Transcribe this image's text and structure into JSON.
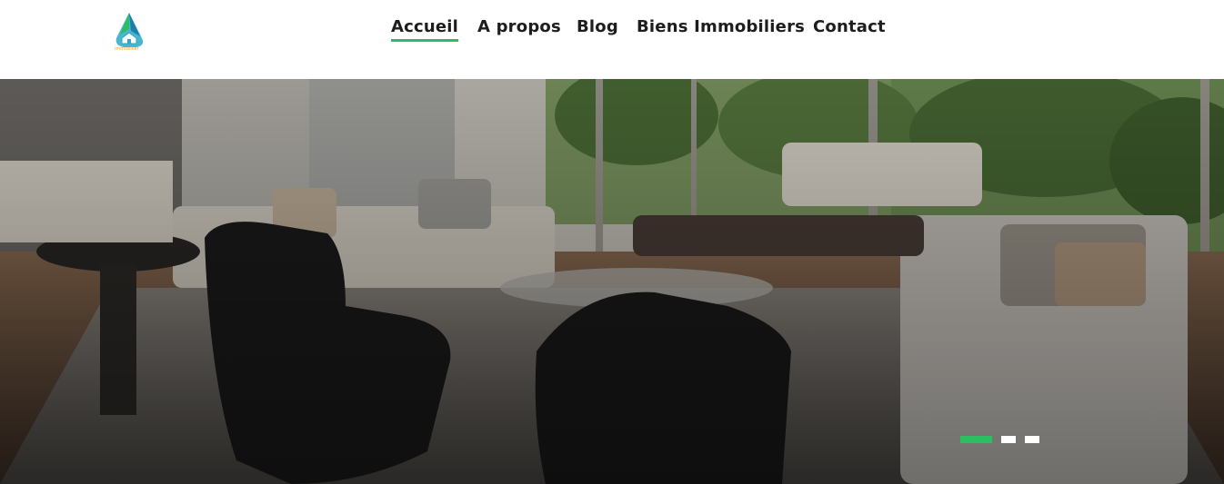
{
  "brand": {
    "logo_icon": "house-drop-logo",
    "logo_text": "immobilier",
    "colors": {
      "green": "#2bbf62",
      "teal": "#2aa7c9",
      "orange": "#f0a020"
    }
  },
  "nav": {
    "items": [
      {
        "label": "Accueil",
        "active": true
      },
      {
        "label": "A propos",
        "active": false
      },
      {
        "label": "Blog",
        "active": false
      },
      {
        "label": "Biens Immobiliers",
        "active": false
      },
      {
        "label": "Contact",
        "active": false
      }
    ],
    "active_color": "#2bbf62"
  },
  "hero": {
    "image": "living-room-interior-photo",
    "slides_total": 3,
    "active_slide": 1
  }
}
